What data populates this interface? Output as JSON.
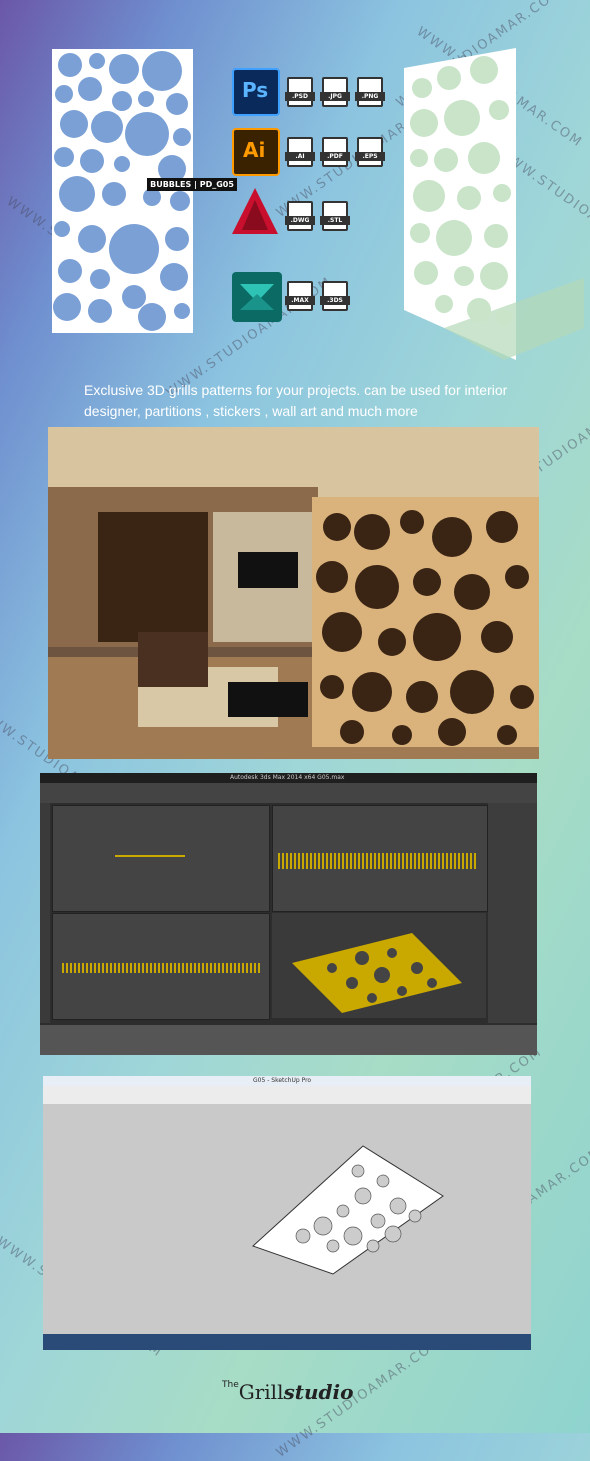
{
  "badge": "BUBBLES | PD_G05",
  "formats": {
    "ps": [
      ".PSD",
      ".JPG",
      ".PNG"
    ],
    "ai": [
      ".AI",
      ".PDF",
      ".EPS"
    ],
    "cad": [
      ".DWG",
      ".STL"
    ],
    "max": [
      ".MAX",
      ".3DS"
    ]
  },
  "app_labels": {
    "ps": "Ps",
    "ai": "Ai"
  },
  "tagline": "Exclusive  3D grills patterns for your projects.  can be used for interior designer, partitions , stickers , wall art and much more",
  "watermark": "WWW.STUDIOAMAR.COM",
  "max_window": {
    "title": "Autodesk 3ds Max 2014 x64    G05.max"
  },
  "sketchup_window": {
    "title": "G05 - SketchUp Pro"
  },
  "logo": {
    "prefix": "The",
    "word": "Grill",
    "script": "studio"
  },
  "colors": {
    "accent_gold": "#c9a800",
    "panel_tan": "#d9b27c"
  }
}
